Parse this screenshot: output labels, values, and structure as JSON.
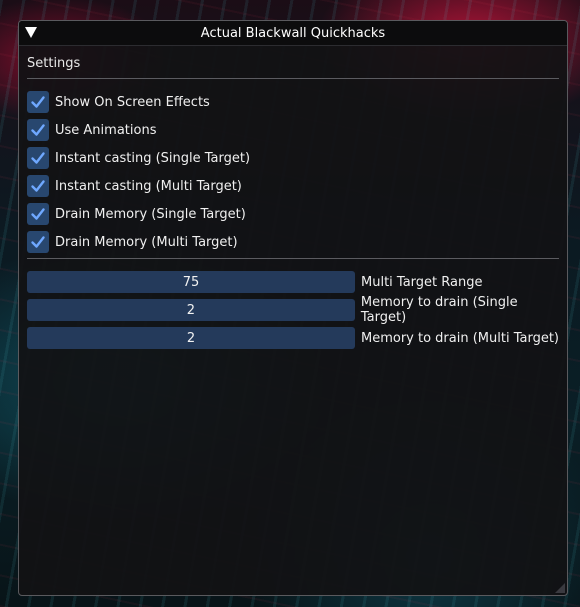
{
  "window": {
    "title": "Actual Blackwall Quickhacks",
    "section": "Settings"
  },
  "checkboxes": [
    {
      "label": "Show On Screen Effects",
      "checked": true
    },
    {
      "label": "Use Animations",
      "checked": true
    },
    {
      "label": "Instant casting (Single Target)",
      "checked": true
    },
    {
      "label": "Instant casting (Multi Target)",
      "checked": true
    },
    {
      "label": "Drain Memory (Single Target)",
      "checked": true
    },
    {
      "label": "Drain Memory (Multi Target)",
      "checked": true
    }
  ],
  "sliders": [
    {
      "value": "75",
      "label": "Multi Target Range"
    },
    {
      "value": "2",
      "label": "Memory to drain (Single Target)"
    },
    {
      "value": "2",
      "label": "Memory to drain (Multi Target)"
    }
  ],
  "colors": {
    "accent": "#28476f",
    "check": "#6fa8ff",
    "slider_bg": "#243a5b",
    "window_bg": "#121214"
  }
}
